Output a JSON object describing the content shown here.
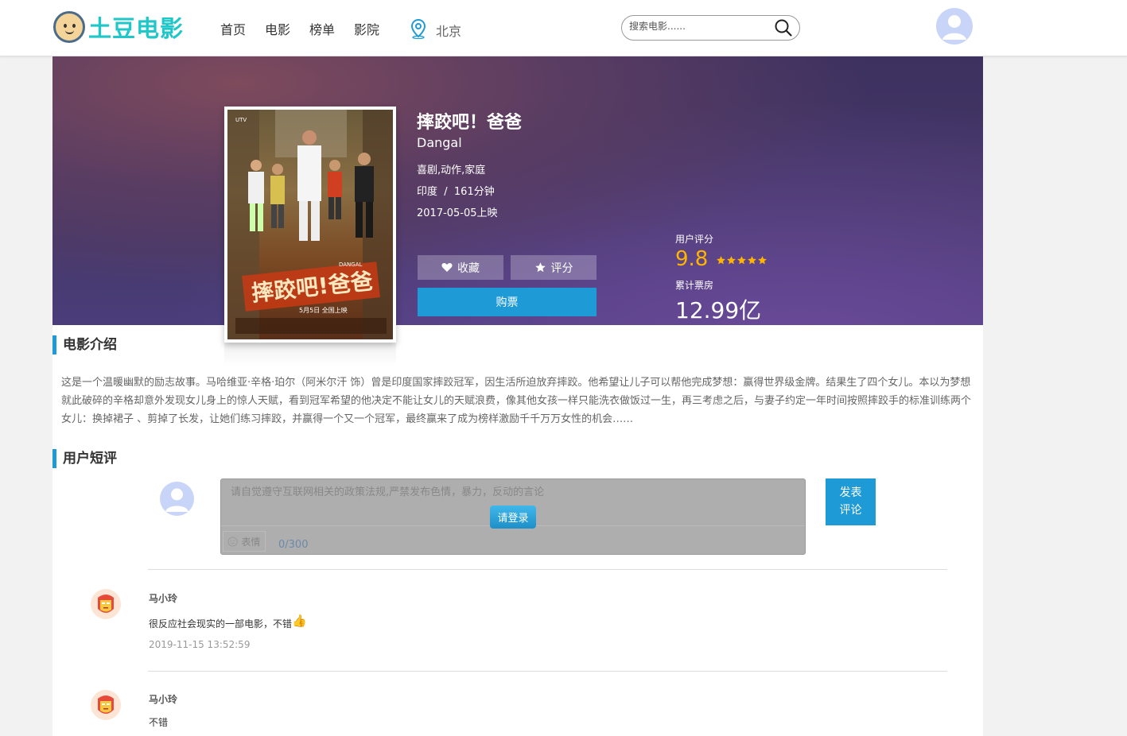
{
  "header": {
    "logo_text": "土豆电影",
    "nav": [
      "首页",
      "电影",
      "榜单",
      "影院"
    ],
    "city": "北京",
    "search_placeholder": "搜索电影......"
  },
  "movie": {
    "title": "摔跤吧！爸爸",
    "english_title": "Dangal",
    "genres": "喜剧,动作,家庭",
    "country_duration": "印度  /  161分钟",
    "release": "2017-05-05上映",
    "fav_label": "收藏",
    "rate_label": "评分",
    "buy_label": "购票",
    "score_label": "用户评分",
    "score": "9.8",
    "box_office_label": "累计票房",
    "box_office": "12.99亿",
    "stars": 5
  },
  "intro": {
    "heading": "电影介绍",
    "text": "这是一个温暖幽默的励志故事。马哈维亚·辛格·珀尔（阿米尔汗 饰）曾是印度国家摔跤冠军，因生活所迫放弃摔跤。他希望让儿子可以帮他完成梦想：赢得世界级金牌。结果生了四个女儿。本以为梦想就此破碎的辛格却意外发现女儿身上的惊人天赋，看到冠军希望的他决定不能让女儿的天赋浪费，像其他女孩一样只能洗衣做饭过一生，再三考虑之后，与妻子约定一年时间按照摔跤手的标准训练两个女儿：换掉裙子 、剪掉了长发，让她们练习摔跤，并赢得一个又一个冠军，最终赢来了成为榜样激励千千万万女性的机会……"
  },
  "reviews": {
    "heading": "用户短评",
    "input_placeholder": "请自觉遵守互联网相关的政策法规,严禁发布色情，暴力，反动的言论",
    "login_label": "请登录",
    "emoji_label": "表情",
    "counter": "0/300",
    "post_label_1": "发表",
    "post_label_2": "评论",
    "items": [
      {
        "user": "马小玲",
        "text": "很反应社会现实的一部电影，不错",
        "emoji": "👍",
        "time": "2019-11-15 13:52:59"
      },
      {
        "user": "马小玲",
        "text": "不错",
        "emoji": "",
        "time": ""
      }
    ]
  },
  "colors": {
    "accent": "#1e9ad6",
    "score": "#ffb400",
    "logo": "#1fc7c9"
  }
}
